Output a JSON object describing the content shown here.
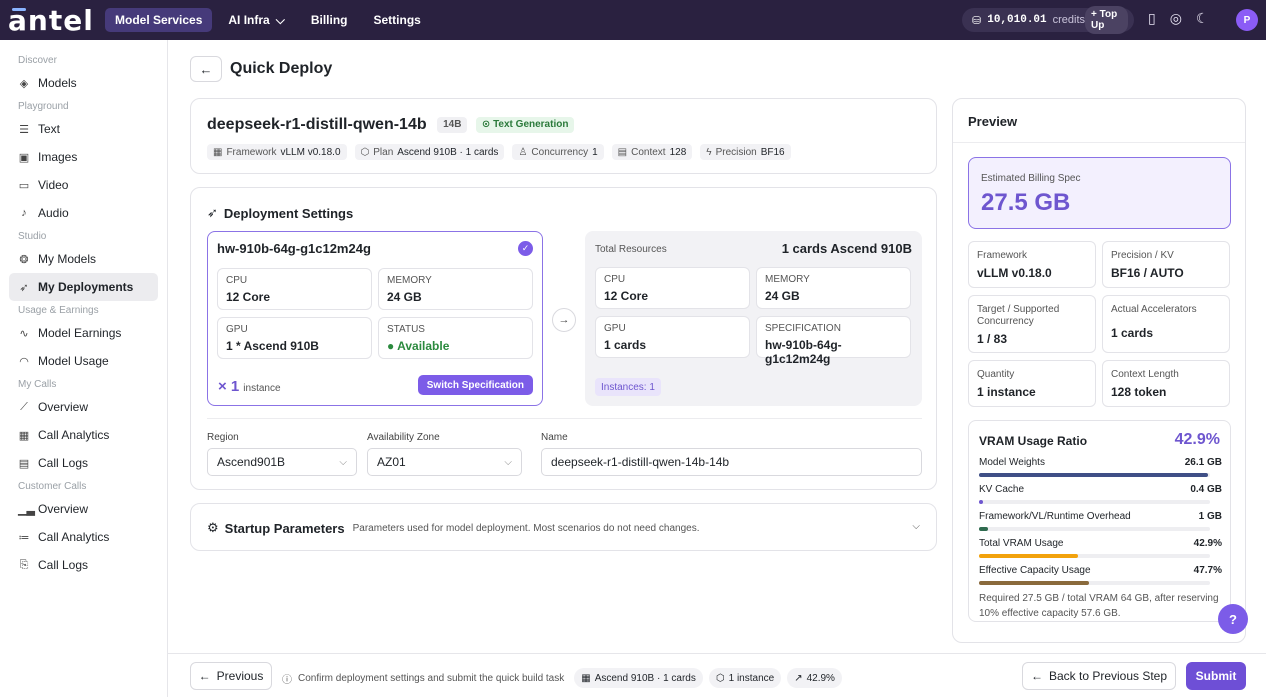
{
  "brand": {
    "logo": "antel"
  },
  "topnav": {
    "items": [
      {
        "label": "Model Services"
      },
      {
        "label": "AI Infra"
      },
      {
        "label": "Billing"
      },
      {
        "label": "Settings"
      }
    ]
  },
  "credits": {
    "amount": "10,010.01",
    "label": "credits",
    "topup": "+ Top Up"
  },
  "user": {
    "initial": "P"
  },
  "sidebar": {
    "discover": "Discover",
    "models": "Models",
    "playground": "Playground",
    "text": "Text",
    "images": "Images",
    "video": "Video",
    "audio": "Audio",
    "studio": "Studio",
    "my_models": "My Models",
    "my_deployments": "My Deployments",
    "usage_earnings": "Usage & Earnings",
    "model_earnings": "Model Earnings",
    "model_usage": "Model Usage",
    "my_calls": "My Calls",
    "overview": "Overview",
    "call_analytics": "Call Analytics",
    "call_logs": "Call Logs",
    "customer_calls": "Customer Calls",
    "overview2": "Overview",
    "call_analytics2": "Call Analytics",
    "call_logs2": "Call Logs"
  },
  "page": {
    "title": "Quick Deploy"
  },
  "model": {
    "name": "deepseek-r1-distill-qwen-14b",
    "size": "14B",
    "task": "Text Generation",
    "meta": {
      "framework_k": "Framework",
      "framework_v": "vLLM v0.18.0",
      "plan_k": "Plan",
      "plan_v": "Ascend 910B · 1 cards",
      "concurrency_k": "Concurrency",
      "concurrency_v": "1",
      "context_k": "Context",
      "context_v": "128",
      "precision_k": "Precision",
      "precision_v": "BF16"
    }
  },
  "deploy": {
    "title": "Deployment Settings",
    "spec": {
      "name": "hw-910b-64g-g1c12m24g",
      "cpu_k": "CPU",
      "cpu_v": "12 Core",
      "mem_k": "MEMORY",
      "mem_v": "24 GB",
      "gpu_k": "GPU",
      "gpu_v": "1 * Ascend 910B",
      "status_k": "STATUS",
      "status_v": "● Available",
      "qty": "× 1",
      "qty_unit": "instance",
      "switch": "Switch Specification"
    },
    "total": {
      "label": "Total Resources",
      "value": "1 cards Ascend 910B",
      "cpu_k": "CPU",
      "cpu_v": "12 Core",
      "mem_k": "MEMORY",
      "mem_v": "24 GB",
      "gpu_k": "GPU",
      "gpu_v": "1 cards",
      "spec_k": "SPECIFICATION",
      "spec_v": "hw-910b-64g-g1c12m24g",
      "instances": "Instances: 1"
    },
    "region_label": "Region",
    "region_value": "Ascend901B",
    "zone_label": "Availability Zone",
    "zone_value": "AZ01",
    "name_label": "Name",
    "name_value": "deepseek-r1-distill-qwen-14b-14b"
  },
  "startup": {
    "title": "Startup Parameters",
    "desc": "Parameters used for model deployment. Most scenarios do not need changes."
  },
  "preview": {
    "title": "Preview",
    "billing_k": "Estimated Billing Spec",
    "billing_v": "27.5 GB",
    "framework_k": "Framework",
    "framework_v": "vLLM v0.18.0",
    "precision_k": "Precision / KV",
    "precision_v": "BF16 / AUTO",
    "concurrency_k": "Target / Supported Concurrency",
    "concurrency_v": "1 / 83",
    "accel_k": "Actual Accelerators",
    "accel_v": "1 cards",
    "qty_k": "Quantity",
    "qty_v": "1 instance",
    "ctx_k": "Context Length",
    "ctx_v": "128 token",
    "vram": {
      "title": "VRAM Usage Ratio",
      "pct": "42.9%",
      "rows": [
        {
          "label": "Model Weights",
          "value": "26.1 GB",
          "ratio": 0.99,
          "color": "#3f4f86"
        },
        {
          "label": "KV Cache",
          "value": "0.4 GB",
          "ratio": 0.015,
          "color": "#6e56cf"
        },
        {
          "label": "Framework/VL/Runtime Overhead",
          "value": "1 GB",
          "ratio": 0.038,
          "color": "#2f6b4f"
        },
        {
          "label": "Total VRAM Usage",
          "value": "42.9%",
          "ratio": 0.429,
          "color": "#f2a20c"
        },
        {
          "label": "Effective Capacity Usage",
          "value": "47.7%",
          "ratio": 0.477,
          "color": "#8a6a3c"
        }
      ],
      "note": "Required 27.5 GB / total VRAM 64 GB, after reserving 10% effective capacity 57.6 GB."
    }
  },
  "footer": {
    "previous": "Previous",
    "confirm": "Confirm deployment settings and submit the quick build task",
    "chip1": "Ascend 910B · 1 cards",
    "chip2": "1 instance",
    "chip3": "42.9%",
    "back_step": "Back to Previous Step",
    "submit": "Submit"
  }
}
